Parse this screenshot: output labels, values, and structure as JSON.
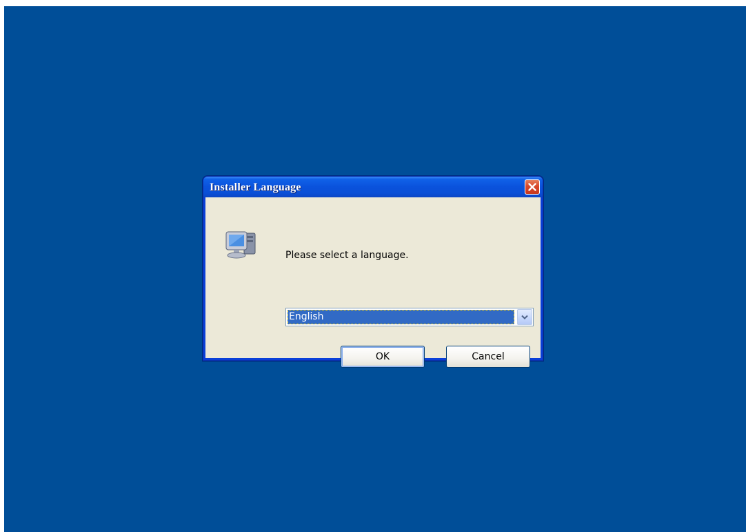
{
  "dialog": {
    "title": "Installer Language",
    "prompt": "Please select a language.",
    "language_select": {
      "selected": "English"
    },
    "ok_label": "OK",
    "cancel_label": "Cancel",
    "icons": {
      "close": "close-icon",
      "app": "computer-installer-icon",
      "dropdown": "chevron-down-icon"
    }
  },
  "colors": {
    "desktop": "#004e98",
    "titlebar": "#0a52dc",
    "client": "#ece9d8",
    "selection": "#316ac5",
    "close_button": "#d8472a"
  }
}
